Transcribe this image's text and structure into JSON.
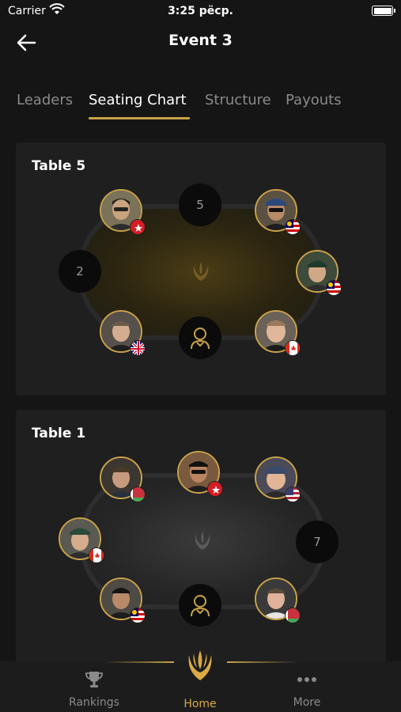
{
  "status": {
    "carrier": "Carrier",
    "time": "3:25 рёср."
  },
  "header": {
    "title": "Event 3"
  },
  "tabs": [
    {
      "label": "Leaders"
    },
    {
      "label": "Seating Chart"
    },
    {
      "label": "Structure"
    },
    {
      "label": "Payouts"
    }
  ],
  "tables": [
    {
      "name": "Table 5",
      "empty_seats": [
        "5",
        "2"
      ],
      "felt": "gold"
    },
    {
      "name": "Table 1",
      "empty_seats": [
        "7"
      ],
      "felt": "gray"
    }
  ],
  "bottom_nav": {
    "rankings": "Rankings",
    "home": "Home",
    "more": "More"
  },
  "colors": {
    "accent": "#c9a24a",
    "background": "#151515",
    "card": "#1f1f1f"
  }
}
